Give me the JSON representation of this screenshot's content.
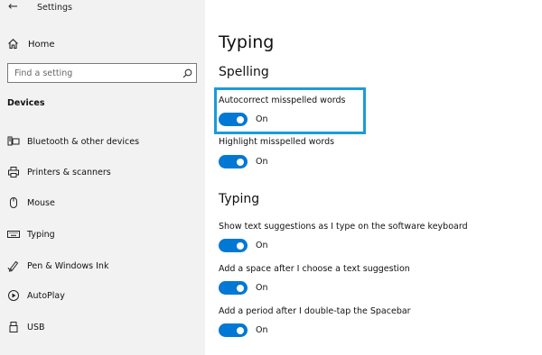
{
  "window": {
    "title": "Settings",
    "back_glyph": "←"
  },
  "sidebar": {
    "home_label": "Home",
    "search": {
      "placeholder": "Find a setting",
      "value": ""
    },
    "section_label": "Devices",
    "items": [
      {
        "label": "Bluetooth & other devices",
        "icon": "bluetooth-devices-icon"
      },
      {
        "label": "Printers & scanners",
        "icon": "printer-icon"
      },
      {
        "label": "Mouse",
        "icon": "mouse-icon"
      },
      {
        "label": "Typing",
        "icon": "keyboard-icon"
      },
      {
        "label": "Pen & Windows Ink",
        "icon": "pen-icon"
      },
      {
        "label": "AutoPlay",
        "icon": "autoplay-icon"
      },
      {
        "label": "USB",
        "icon": "usb-icon"
      }
    ]
  },
  "main": {
    "title": "Typing",
    "sections": [
      {
        "heading": "Spelling",
        "settings": [
          {
            "label": "Autocorrect misspelled words",
            "state": "On",
            "on": true,
            "highlighted": true
          },
          {
            "label": "Highlight misspelled words",
            "state": "On",
            "on": true
          }
        ]
      },
      {
        "heading": "Typing",
        "settings": [
          {
            "label": "Show text suggestions as I type on the software keyboard",
            "state": "On",
            "on": true
          },
          {
            "label": "Add a space after I choose a text suggestion",
            "state": "On",
            "on": true
          },
          {
            "label": "Add a period after I double-tap the Spacebar",
            "state": "On",
            "on": true
          }
        ]
      }
    ]
  },
  "colors": {
    "accent": "#0078d4",
    "highlight": "#1a9bdc",
    "sidebar_bg": "#f2f2f2"
  }
}
